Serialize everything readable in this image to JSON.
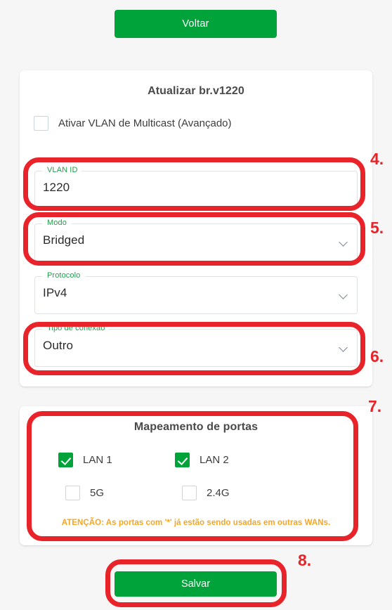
{
  "theme": {
    "accent_green": "#00a339",
    "label_green": "#1d9e4b",
    "warning_orange": "#f6a623",
    "annotation_red": "#e8232a",
    "page_background": "#f6f6f6",
    "card_background": "#ffffff"
  },
  "top": {
    "back_button_label": "Voltar"
  },
  "main_card": {
    "title": "Atualizar br.v1220",
    "multicast_checkbox": {
      "label": "Ativar VLAN de Multicast (Avançado)",
      "checked": false
    },
    "fields": [
      {
        "label": "VLAN ID",
        "value": "1220",
        "type": "text",
        "has_chevron": false
      },
      {
        "label": "Modo",
        "value": "Bridged",
        "type": "select",
        "has_chevron": true
      },
      {
        "label": "Protocolo",
        "value": "IPv4",
        "type": "select",
        "has_chevron": true
      },
      {
        "label": "Tipo de conexão",
        "value": "Outro",
        "type": "select",
        "has_chevron": true
      }
    ]
  },
  "ports_card": {
    "title": "Mapeamento de portas",
    "ports": [
      {
        "label": "LAN 1",
        "checked": true
      },
      {
        "label": "LAN 2",
        "checked": true
      },
      {
        "label": "5G",
        "checked": false
      },
      {
        "label": "2.4G",
        "checked": false
      }
    ],
    "warning": "ATENÇÃO: As portas com '*' já estão sendo usadas em outras WANs."
  },
  "bottom": {
    "save_button_label": "Salvar"
  },
  "annotations": [
    {
      "number": "4."
    },
    {
      "number": "5."
    },
    {
      "number": "6."
    },
    {
      "number": "7."
    },
    {
      "number": "8."
    }
  ]
}
